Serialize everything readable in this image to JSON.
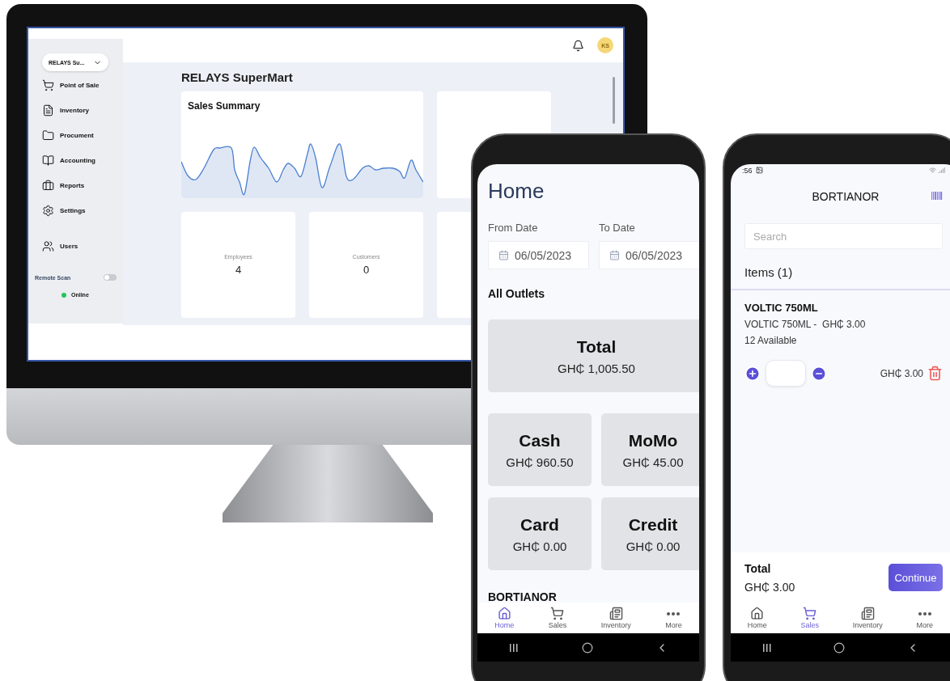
{
  "desktop": {
    "org_select": "RELAYS Su...",
    "nav_sections": [
      [
        {
          "label": "Point of Sale"
        },
        {
          "label": "Inventory"
        },
        {
          "label": "Procument"
        },
        {
          "label": "Accounting"
        },
        {
          "label": "Reports"
        },
        {
          "label": "Settings"
        }
      ],
      [
        {
          "label": "Users"
        }
      ]
    ],
    "remote_scan": {
      "label": "Remote Scan",
      "on": false
    },
    "status": "Online",
    "avatar": "KS",
    "page_title": "RELAYS SuperMart",
    "sales_summary": {
      "title": "Sales Summary"
    },
    "stats": [
      {
        "label": "Employees",
        "value": "4"
      },
      {
        "label": "Customers",
        "value": "0"
      }
    ]
  },
  "phone_home": {
    "title": "Home",
    "from_label": "From Date",
    "from_value": "06/05/2023",
    "to_label": "To Date",
    "to_value": "06/05/2023",
    "section": "All Outlets",
    "total": {
      "label": "Total",
      "value": "GH₵ 1,005.50"
    },
    "methods": [
      {
        "label": "Cash",
        "value": "GH₵ 960.50"
      },
      {
        "label": "MoMo",
        "value": "GH₵ 45.00"
      },
      {
        "label": "Card",
        "value": "GH₵ 0.00"
      },
      {
        "label": "Credit",
        "value": "GH₵ 0.00"
      }
    ],
    "outlet": "BORTIANOR",
    "tabs": [
      {
        "label": "Home",
        "selected": true
      },
      {
        "label": "Sales",
        "selected": false
      },
      {
        "label": "Inventory",
        "selected": false
      },
      {
        "label": "More",
        "selected": false
      }
    ]
  },
  "phone_sales": {
    "time": ":56",
    "title": "BORTIANOR",
    "search": {
      "placeholder": "Search"
    },
    "items_heading": "Items (1)",
    "item": {
      "name": "VOLTIC 750ML",
      "desc": "VOLTIC 750ML -",
      "price": "GH₵ 3.00",
      "stock": "12 Available",
      "line_total": "GH₵ 3.00"
    },
    "total_label": "Total",
    "total_value": "GH₵ 3.00",
    "continue": "Continue",
    "tabs": [
      {
        "label": "Home",
        "selected": false
      },
      {
        "label": "Sales",
        "selected": true
      },
      {
        "label": "Inventory",
        "selected": false
      },
      {
        "label": "More",
        "selected": false
      }
    ]
  }
}
